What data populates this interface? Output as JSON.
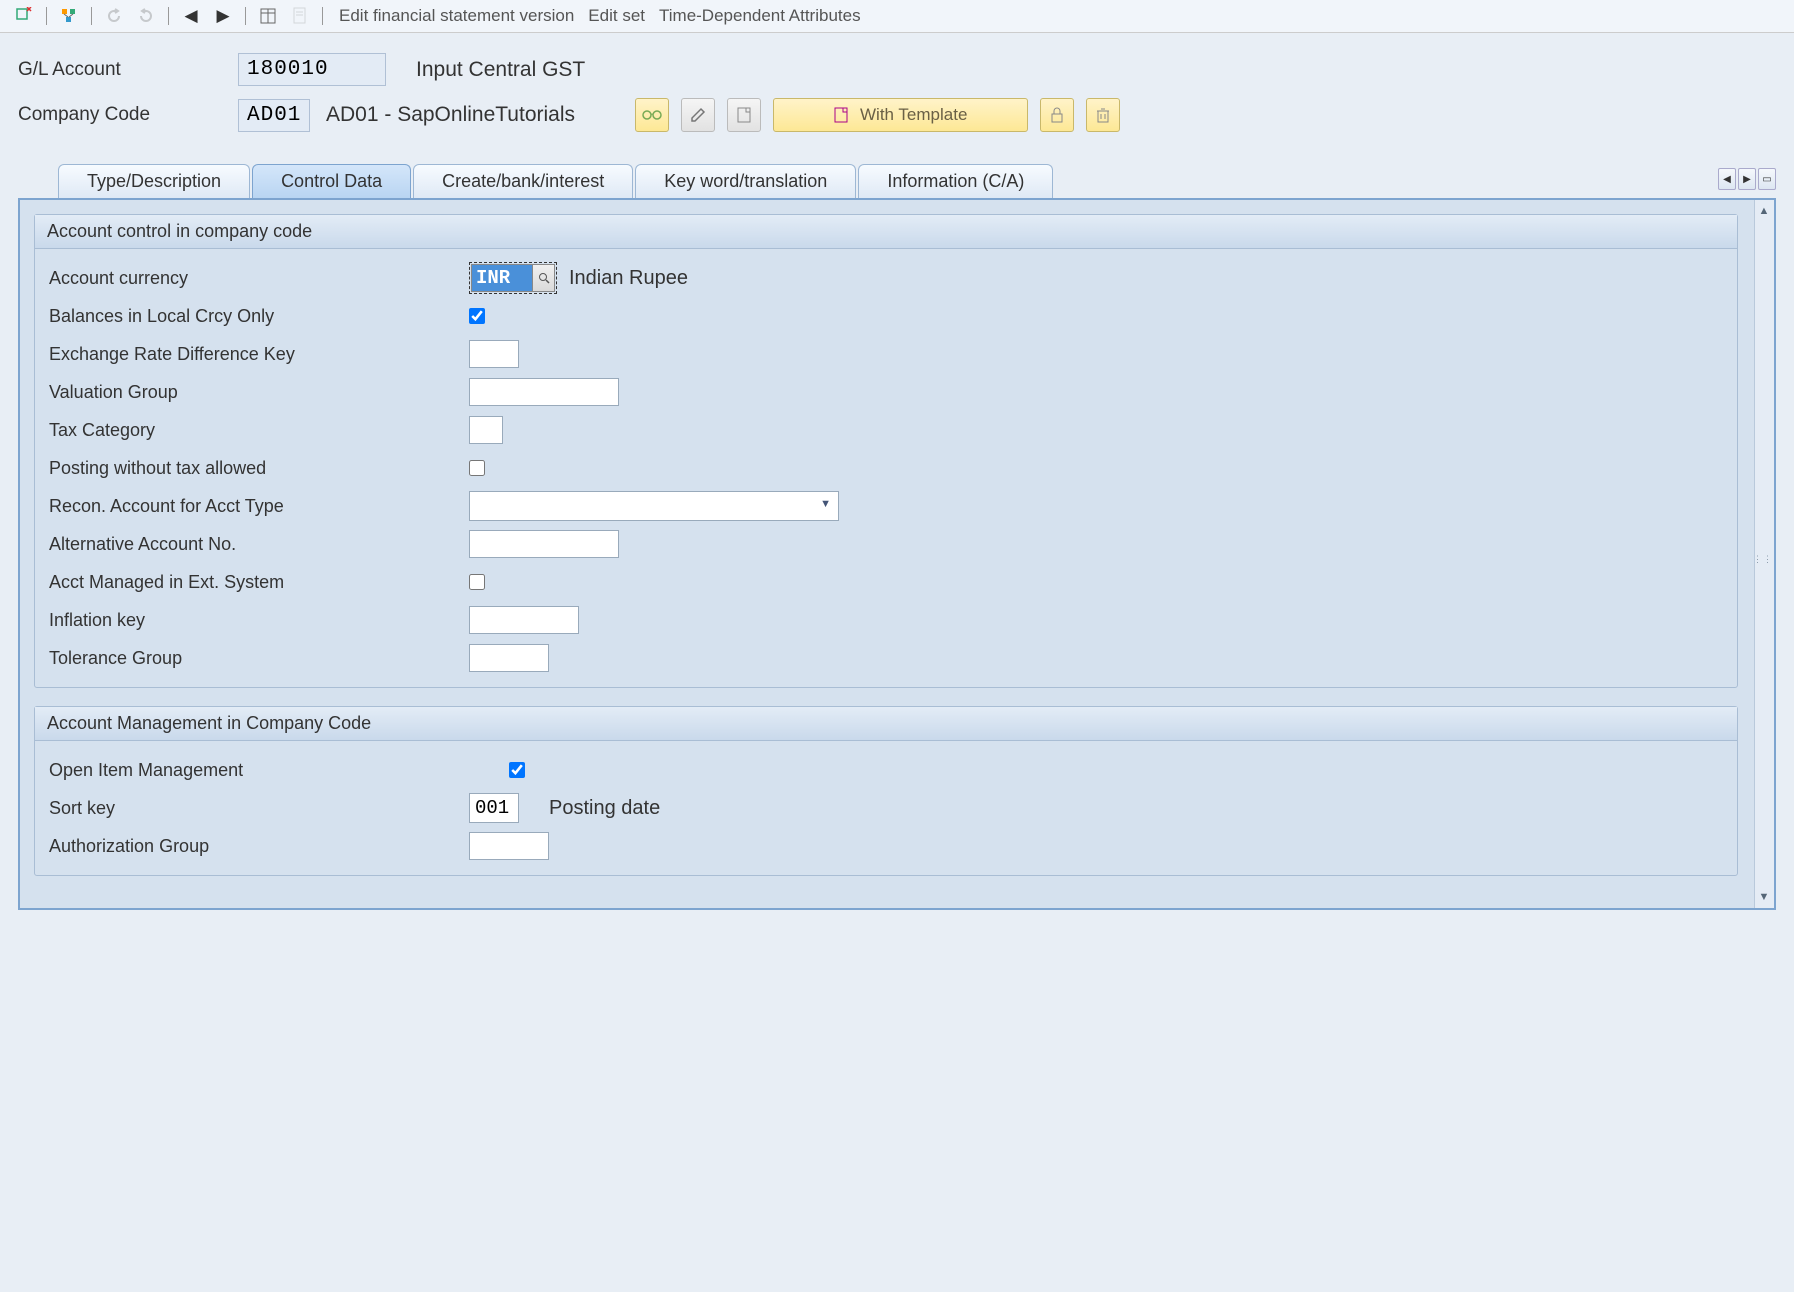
{
  "toolbar": {
    "menu_items": [
      "Edit financial statement version",
      "Edit set",
      "Time-Dependent Attributes"
    ]
  },
  "header": {
    "gl_label": "G/L Account",
    "gl_value": "180010",
    "gl_desc": "Input Central GST",
    "cc_label": "Company Code",
    "cc_value": "AD01",
    "cc_desc": "AD01 - SapOnlineTutorials",
    "with_template": "With Template"
  },
  "tabs": [
    "Type/Description",
    "Control Data",
    "Create/bank/interest",
    "Key word/translation",
    "Information (C/A)"
  ],
  "active_tab": 1,
  "panel1": {
    "title": "Account control in company code",
    "currency_label": "Account currency",
    "currency_value": "INR",
    "currency_desc": "Indian Rupee",
    "balances_label": "Balances in Local Crcy Only",
    "balances_checked": true,
    "exrate_label": "Exchange Rate Difference Key",
    "valgroup_label": "Valuation Group",
    "taxcat_label": "Tax Category",
    "posting_label": "Posting without tax allowed",
    "posting_checked": false,
    "recon_label": "Recon. Account for Acct Type",
    "altacct_label": "Alternative Account No.",
    "extsys_label": "Acct Managed in Ext. System",
    "extsys_checked": false,
    "inflation_label": "Inflation key",
    "tolerance_label": "Tolerance Group"
  },
  "panel2": {
    "title": "Account Management in Company Code",
    "openitem_label": "Open Item Management",
    "openitem_checked": true,
    "sortkey_label": "Sort key",
    "sortkey_value": "001",
    "sortkey_desc": "Posting date",
    "authgroup_label": "Authorization Group"
  }
}
